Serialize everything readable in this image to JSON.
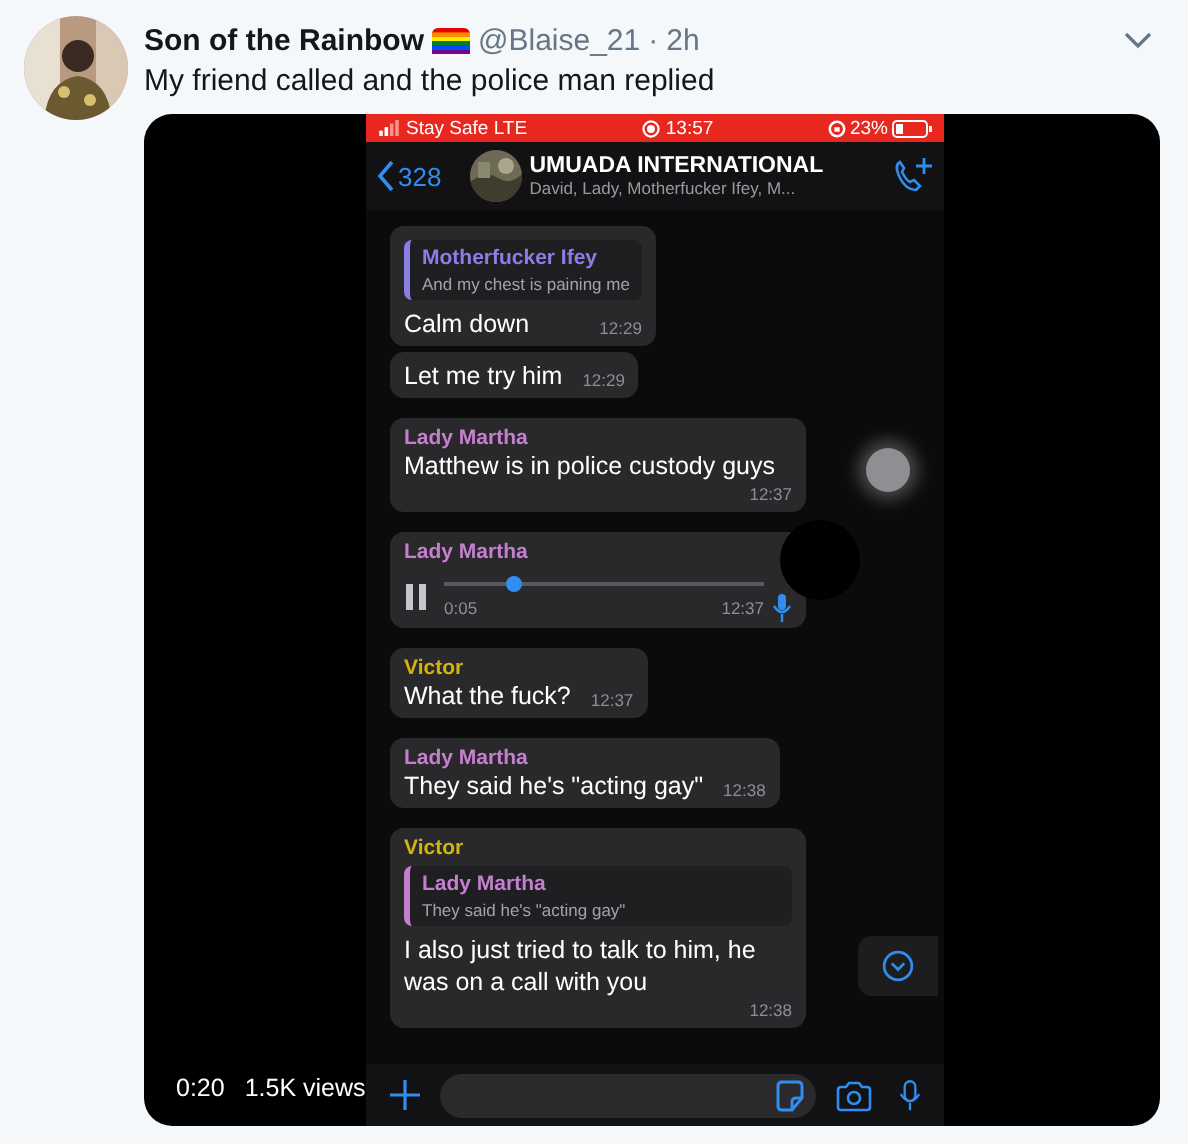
{
  "tweet": {
    "author_name": "Son of the Rainbow",
    "handle": "@Blaise_21",
    "separator": "·",
    "time": "2h",
    "text": "My friend called and the police man replied"
  },
  "video": {
    "duration": "0:20",
    "views": "1.5K views"
  },
  "chat": {
    "status_bar": {
      "carrier": "Stay Safe LTE",
      "time": "13:57",
      "battery": "23%"
    },
    "header": {
      "back_count": "328",
      "title": "UMUADA INTERNATIONAL",
      "members": "David, Lady, Motherfucker Ifey, M..."
    },
    "messages": [
      {
        "kind": "text",
        "quote": {
          "sender": "Motherfucker Ifey",
          "color": "#8a7fe6",
          "text": "And my chest is paining me"
        },
        "text": "Calm down",
        "time": "12:29"
      },
      {
        "kind": "text",
        "text": "Let me try him",
        "time": "12:29"
      },
      {
        "kind": "text",
        "sender": "Lady Martha",
        "color": "#c57fcf",
        "text": "Matthew is in police custody guys",
        "time": "12:37"
      },
      {
        "kind": "voice",
        "sender": "Lady Martha",
        "color": "#c57fcf",
        "level": 0.22,
        "duration": "0:05",
        "time": "12:37"
      },
      {
        "kind": "text",
        "sender": "Victor",
        "color": "#d6b40c",
        "text": "What the fuck?",
        "time": "12:37"
      },
      {
        "kind": "text",
        "sender": "Lady Martha",
        "color": "#c57fcf",
        "text": "They said he's \"acting gay\"",
        "time": "12:38"
      },
      {
        "kind": "text",
        "sender": "Victor",
        "color": "#d6b40c",
        "quote": {
          "sender": "Lady Martha",
          "color": "#c57fcf",
          "text": "They said he's \"acting gay\""
        },
        "text": "I also just tried to talk to him, he was on a call with you",
        "time": "12:38"
      }
    ]
  }
}
